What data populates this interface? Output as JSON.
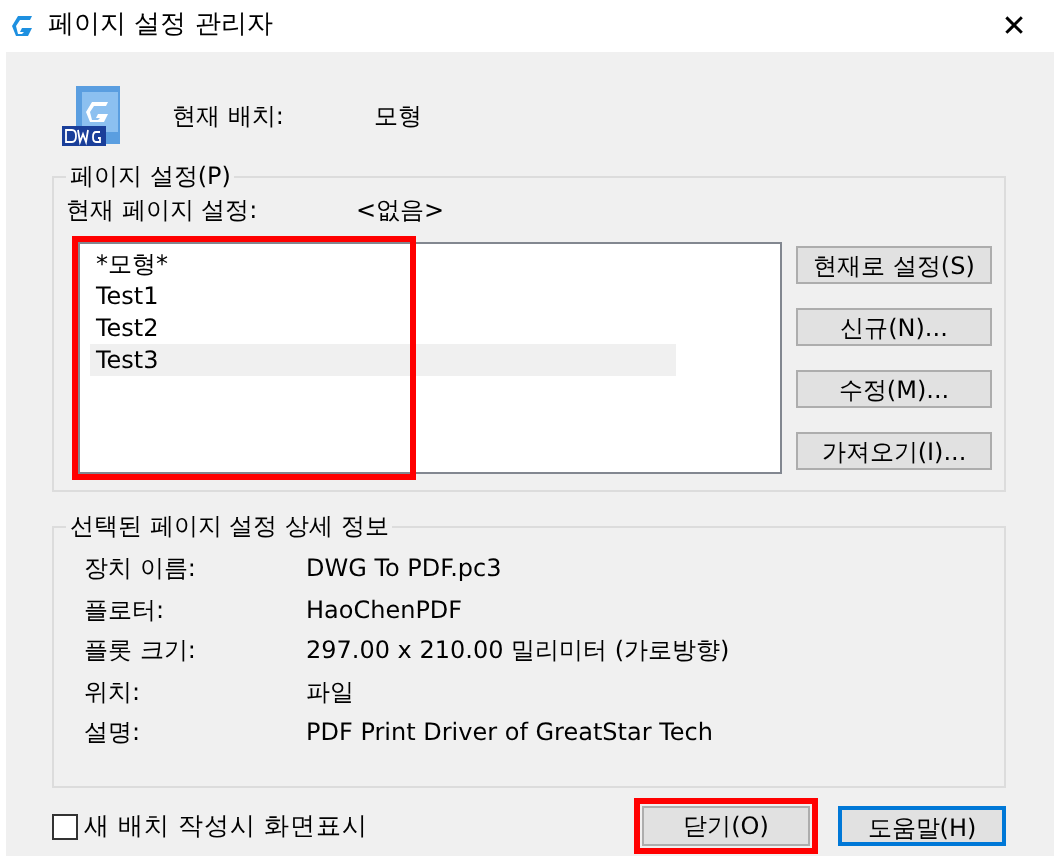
{
  "window": {
    "title": "페이지 설정 관리자",
    "close": "✕"
  },
  "current_layout": {
    "label": "현재 배치:",
    "value": "모형"
  },
  "page_setups": {
    "title": "페이지 설정(P)",
    "current_label": "현재 페이지 설정:",
    "current_value": "<없음>",
    "highlighted": true,
    "items": [
      {
        "label": "*모형*",
        "selected": false
      },
      {
        "label": "Test1",
        "selected": false
      },
      {
        "label": "Test2",
        "selected": false
      },
      {
        "label": "Test3",
        "selected": true
      }
    ],
    "buttons": [
      "현재로 설정(S)",
      "신규(N)...",
      "수정(M)...",
      "가져오기(I)..."
    ]
  },
  "details": {
    "title": "선택된 페이지 설정 상세 정보",
    "rows": [
      {
        "label": "장치 이름:",
        "value": "DWG To PDF.pc3"
      },
      {
        "label": "플로터:",
        "value": "HaoChenPDF"
      },
      {
        "label": "플롯 크기:",
        "value": "297.00 x 210.00 밀리미터 (가로방향)"
      },
      {
        "label": "위치:",
        "value": "파일"
      },
      {
        "label": "설명:",
        "value": "PDF Print Driver of GreatStar Tech"
      }
    ]
  },
  "show_on_new_layout": {
    "label": "새 배치 작성시 화면표시",
    "checked": false
  },
  "footer_buttons": [
    {
      "label": "닫기(O)",
      "highlighted": true,
      "focused": false
    },
    {
      "label": "도움말(H)",
      "highlighted": false,
      "focused": true
    }
  ]
}
